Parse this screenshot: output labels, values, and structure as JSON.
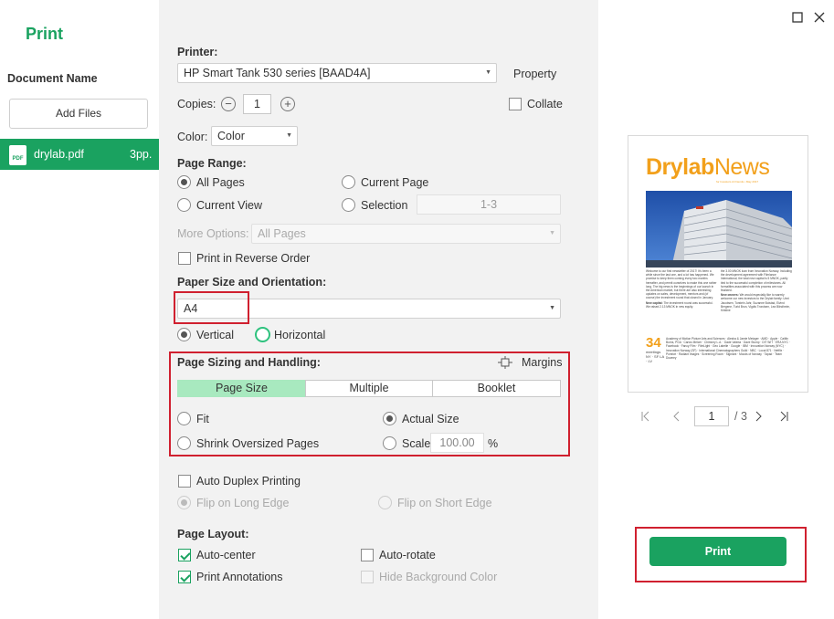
{
  "app": {
    "title": "Print"
  },
  "documents": {
    "header": "Document Name",
    "add_files_label": "Add Files",
    "items": [
      {
        "name": "drylab.pdf",
        "pages": "3pp.",
        "icon": "pdf-file-icon"
      }
    ]
  },
  "settings": {
    "printer": {
      "label": "Printer:",
      "value": "HP Smart Tank 530 series [BAAD4A]",
      "property_label": "Property"
    },
    "copies": {
      "label": "Copies:",
      "value": "1",
      "collate_label": "Collate",
      "collate_checked": false
    },
    "color": {
      "label": "Color:",
      "value": "Color"
    },
    "page_range": {
      "label": "Page Range:",
      "all_pages": "All Pages",
      "current_page": "Current Page",
      "current_view": "Current View",
      "selection": "Selection",
      "selection_placeholder": "1-3",
      "selected": "all_pages"
    },
    "more_options": {
      "label": "More Options:",
      "value": "All Pages"
    },
    "reverse_order": {
      "label": "Print in Reverse Order",
      "checked": false
    },
    "paper": {
      "label": "Paper Size and Orientation:",
      "size": "A4",
      "vertical": "Vertical",
      "horizontal": "Horizontal",
      "selected": "vertical"
    },
    "sizing": {
      "label": "Page Sizing and Handling:",
      "margins_label": "Margins",
      "tabs": [
        "Page Size",
        "Multiple",
        "Booklet"
      ],
      "active_tab": "Page Size",
      "fit": "Fit",
      "actual_size": "Actual Size",
      "shrink": "Shrink Oversized Pages",
      "scale": "Scale",
      "scale_value": "100.00",
      "scale_unit": "%",
      "selected": "actual_size"
    },
    "duplex": {
      "label": "Auto Duplex Printing",
      "checked": false,
      "long_edge": "Flip on Long Edge",
      "short_edge": "Flip on Short Edge"
    },
    "layout": {
      "label": "Page Layout:",
      "auto_center": "Auto-center",
      "auto_rotate": "Auto-rotate",
      "print_annotations": "Print Annotations",
      "hide_background": "Hide Background Color"
    }
  },
  "preview": {
    "thumbnail": {
      "brand_a": "Drylab",
      "brand_b": "News",
      "subtitle": "for Investors & Friends • May 2017",
      "big_number": "34",
      "col1": "Welcome to our first newsletter of 2017! It's been a while since the last one, and a lot has happened. We promise to keep them coming every two months hereafter, and permit ourselves to make this one rather long. The big news is the beginnings of our launch in the American market, but there are also interesting updates on sales, development, mentors and (of course) the investment round that closed in January.",
      "col2": "the 3.00 MNOK loan from Innovation Norway. Including the development agreement with Filmlance International, the total new capital is 5 MNOK, partly tied to the successful completion of milestones. All formalities associated with this process are now finalized.",
      "bold1": "New capital:",
      "body1": "The investment round was successful. We raised 2.13 MNOK in new equity.",
      "bold2": "New owners:",
      "body2": "We would especially like to warmly welcome our new investors to the Drylab family: Unni Jacobsen, Torstein Jahr, Suzanne Bolstad, Eivind Bergene, Turid Brun, Vigdis Trondsen, Lea Blindheim, Kristine",
      "side_small": "meetings NY · SF LA · LV",
      "list": "Academy of Motion Picture Arts and Sciences · Alesha & Jamie Metzger · AMD · Apple · Caitlin Burns, PGA · Carlos Melcer · Chimney L.A. · Dade Valeria · Dave Stump · DIT WIT · ERA NYC · Facebook · Fancy Film · FilmLight · Geo Labelle · Google · IBM · Innovation Norway (NYC) · Innovation Norway (SF) · International Cinematographers Guild · NBC · Local 871 · Netflix · Pomfort · Radiant Images · Screening Room · Signiant · Moods of Norway · Tapad · Team Downey"
    },
    "page_input": "1",
    "page_total": "/ 3",
    "print_label": "Print"
  }
}
